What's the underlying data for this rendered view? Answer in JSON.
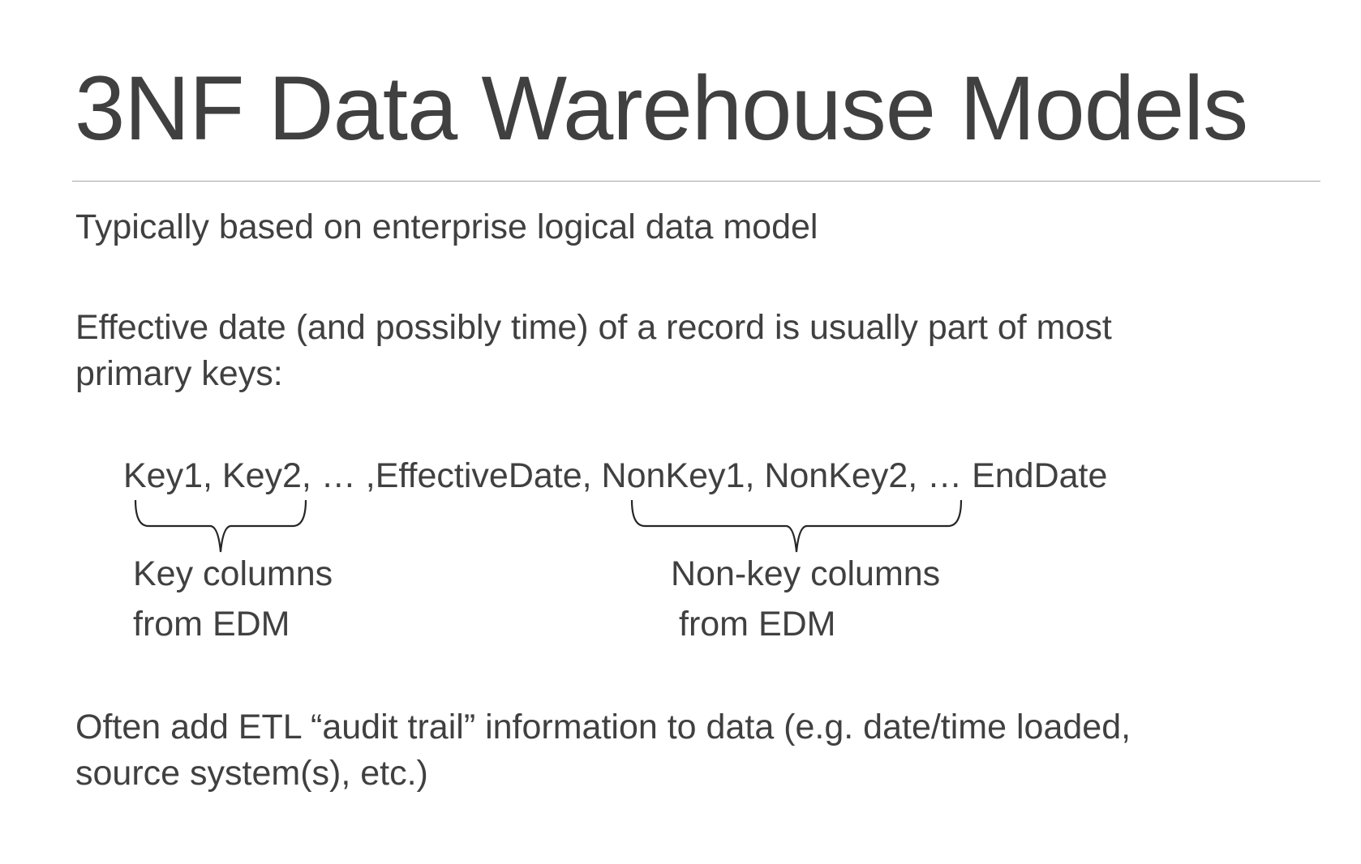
{
  "slide": {
    "title": "3NF Data Warehouse Models",
    "bullet1": "Typically based on enterprise logical data model",
    "bullet2_line1": "Effective date (and possibly time) of a record is usually part of most",
    "bullet2_line2": "primary keys:",
    "key_sequence": "Key1, Key2, … ,EffectiveDate, NonKey1, NonKey2, … EndDate",
    "key_label_line1": "Key columns",
    "key_label_line2": "from EDM",
    "nonkey_label_line1": "Non-key columns",
    "nonkey_label_line2": "from EDM",
    "bullet3_line1": "Often add ETL “audit trail” information to data (e.g. date/time loaded,",
    "bullet3_line2": "source system(s), etc.)"
  }
}
